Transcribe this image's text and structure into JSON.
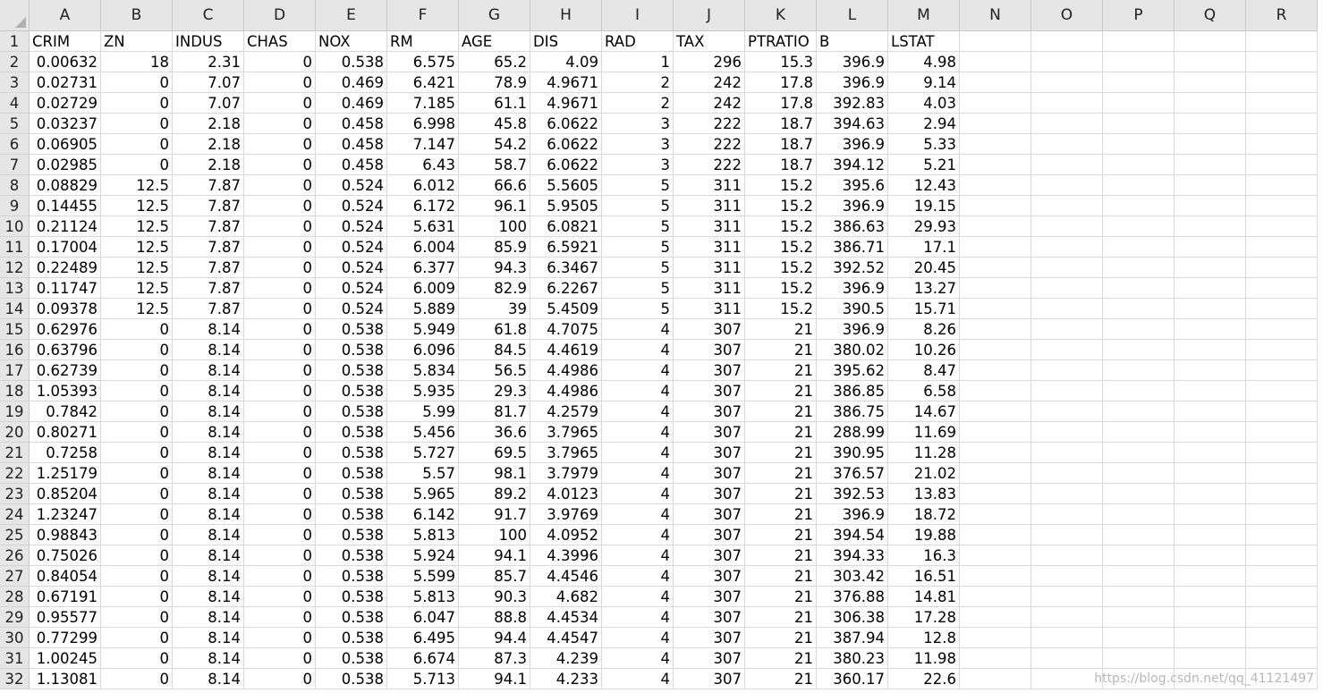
{
  "columns": [
    "A",
    "B",
    "C",
    "D",
    "E",
    "F",
    "G",
    "H",
    "I",
    "J",
    "K",
    "L",
    "M",
    "N",
    "O",
    "P",
    "Q",
    "R"
  ],
  "rows": [
    [
      "CRIM",
      "ZN",
      "INDUS",
      "CHAS",
      "NOX",
      "RM",
      "AGE",
      "DIS",
      "RAD",
      "TAX",
      "PTRATIO",
      "B",
      "LSTAT"
    ],
    [
      "0.00632",
      "18",
      "2.31",
      "0",
      "0.538",
      "6.575",
      "65.2",
      "4.09",
      "1",
      "296",
      "15.3",
      "396.9",
      "4.98"
    ],
    [
      "0.02731",
      "0",
      "7.07",
      "0",
      "0.469",
      "6.421",
      "78.9",
      "4.9671",
      "2",
      "242",
      "17.8",
      "396.9",
      "9.14"
    ],
    [
      "0.02729",
      "0",
      "7.07",
      "0",
      "0.469",
      "7.185",
      "61.1",
      "4.9671",
      "2",
      "242",
      "17.8",
      "392.83",
      "4.03"
    ],
    [
      "0.03237",
      "0",
      "2.18",
      "0",
      "0.458",
      "6.998",
      "45.8",
      "6.0622",
      "3",
      "222",
      "18.7",
      "394.63",
      "2.94"
    ],
    [
      "0.06905",
      "0",
      "2.18",
      "0",
      "0.458",
      "7.147",
      "54.2",
      "6.0622",
      "3",
      "222",
      "18.7",
      "396.9",
      "5.33"
    ],
    [
      "0.02985",
      "0",
      "2.18",
      "0",
      "0.458",
      "6.43",
      "58.7",
      "6.0622",
      "3",
      "222",
      "18.7",
      "394.12",
      "5.21"
    ],
    [
      "0.08829",
      "12.5",
      "7.87",
      "0",
      "0.524",
      "6.012",
      "66.6",
      "5.5605",
      "5",
      "311",
      "15.2",
      "395.6",
      "12.43"
    ],
    [
      "0.14455",
      "12.5",
      "7.87",
      "0",
      "0.524",
      "6.172",
      "96.1",
      "5.9505",
      "5",
      "311",
      "15.2",
      "396.9",
      "19.15"
    ],
    [
      "0.21124",
      "12.5",
      "7.87",
      "0",
      "0.524",
      "5.631",
      "100",
      "6.0821",
      "5",
      "311",
      "15.2",
      "386.63",
      "29.93"
    ],
    [
      "0.17004",
      "12.5",
      "7.87",
      "0",
      "0.524",
      "6.004",
      "85.9",
      "6.5921",
      "5",
      "311",
      "15.2",
      "386.71",
      "17.1"
    ],
    [
      "0.22489",
      "12.5",
      "7.87",
      "0",
      "0.524",
      "6.377",
      "94.3",
      "6.3467",
      "5",
      "311",
      "15.2",
      "392.52",
      "20.45"
    ],
    [
      "0.11747",
      "12.5",
      "7.87",
      "0",
      "0.524",
      "6.009",
      "82.9",
      "6.2267",
      "5",
      "311",
      "15.2",
      "396.9",
      "13.27"
    ],
    [
      "0.09378",
      "12.5",
      "7.87",
      "0",
      "0.524",
      "5.889",
      "39",
      "5.4509",
      "5",
      "311",
      "15.2",
      "390.5",
      "15.71"
    ],
    [
      "0.62976",
      "0",
      "8.14",
      "0",
      "0.538",
      "5.949",
      "61.8",
      "4.7075",
      "4",
      "307",
      "21",
      "396.9",
      "8.26"
    ],
    [
      "0.63796",
      "0",
      "8.14",
      "0",
      "0.538",
      "6.096",
      "84.5",
      "4.4619",
      "4",
      "307",
      "21",
      "380.02",
      "10.26"
    ],
    [
      "0.62739",
      "0",
      "8.14",
      "0",
      "0.538",
      "5.834",
      "56.5",
      "4.4986",
      "4",
      "307",
      "21",
      "395.62",
      "8.47"
    ],
    [
      "1.05393",
      "0",
      "8.14",
      "0",
      "0.538",
      "5.935",
      "29.3",
      "4.4986",
      "4",
      "307",
      "21",
      "386.85",
      "6.58"
    ],
    [
      "0.7842",
      "0",
      "8.14",
      "0",
      "0.538",
      "5.99",
      "81.7",
      "4.2579",
      "4",
      "307",
      "21",
      "386.75",
      "14.67"
    ],
    [
      "0.80271",
      "0",
      "8.14",
      "0",
      "0.538",
      "5.456",
      "36.6",
      "3.7965",
      "4",
      "307",
      "21",
      "288.99",
      "11.69"
    ],
    [
      "0.7258",
      "0",
      "8.14",
      "0",
      "0.538",
      "5.727",
      "69.5",
      "3.7965",
      "4",
      "307",
      "21",
      "390.95",
      "11.28"
    ],
    [
      "1.25179",
      "0",
      "8.14",
      "0",
      "0.538",
      "5.57",
      "98.1",
      "3.7979",
      "4",
      "307",
      "21",
      "376.57",
      "21.02"
    ],
    [
      "0.85204",
      "0",
      "8.14",
      "0",
      "0.538",
      "5.965",
      "89.2",
      "4.0123",
      "4",
      "307",
      "21",
      "392.53",
      "13.83"
    ],
    [
      "1.23247",
      "0",
      "8.14",
      "0",
      "0.538",
      "6.142",
      "91.7",
      "3.9769",
      "4",
      "307",
      "21",
      "396.9",
      "18.72"
    ],
    [
      "0.98843",
      "0",
      "8.14",
      "0",
      "0.538",
      "5.813",
      "100",
      "4.0952",
      "4",
      "307",
      "21",
      "394.54",
      "19.88"
    ],
    [
      "0.75026",
      "0",
      "8.14",
      "0",
      "0.538",
      "5.924",
      "94.1",
      "4.3996",
      "4",
      "307",
      "21",
      "394.33",
      "16.3"
    ],
    [
      "0.84054",
      "0",
      "8.14",
      "0",
      "0.538",
      "5.599",
      "85.7",
      "4.4546",
      "4",
      "307",
      "21",
      "303.42",
      "16.51"
    ],
    [
      "0.67191",
      "0",
      "8.14",
      "0",
      "0.538",
      "5.813",
      "90.3",
      "4.682",
      "4",
      "307",
      "21",
      "376.88",
      "14.81"
    ],
    [
      "0.95577",
      "0",
      "8.14",
      "0",
      "0.538",
      "6.047",
      "88.8",
      "4.4534",
      "4",
      "307",
      "21",
      "306.38",
      "17.28"
    ],
    [
      "0.77299",
      "0",
      "8.14",
      "0",
      "0.538",
      "6.495",
      "94.4",
      "4.4547",
      "4",
      "307",
      "21",
      "387.94",
      "12.8"
    ],
    [
      "1.00245",
      "0",
      "8.14",
      "0",
      "0.538",
      "6.674",
      "87.3",
      "4.239",
      "4",
      "307",
      "21",
      "380.23",
      "11.98"
    ],
    [
      "1.13081",
      "0",
      "8.14",
      "0",
      "0.538",
      "5.713",
      "94.1",
      "4.233",
      "4",
      "307",
      "21",
      "360.17",
      "22.6"
    ]
  ],
  "watermark": "https://blog.csdn.net/qq_41121497"
}
